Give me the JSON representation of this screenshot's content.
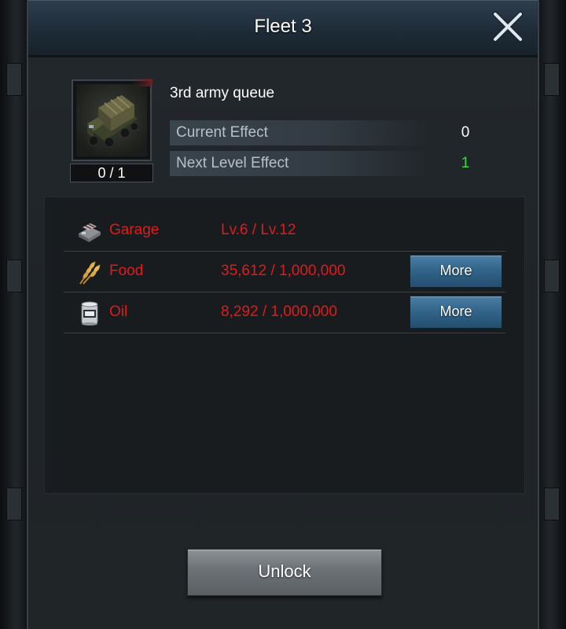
{
  "header": {
    "title": "Fleet 3"
  },
  "item": {
    "count": "0 / 1",
    "title": "3rd army queue"
  },
  "effects": [
    {
      "label": "Current Effect",
      "value": "0",
      "value_color": "#ffffff"
    },
    {
      "label": "Next Level Effect",
      "value": "1",
      "value_color": "#3ddc3d"
    }
  ],
  "requirements": [
    {
      "icon": "garage-icon",
      "name": "Garage",
      "amount": "Lv.6 / Lv.12",
      "button": null
    },
    {
      "icon": "wheat-icon",
      "name": "Food",
      "amount": "35,612 / 1,000,000",
      "button": "More"
    },
    {
      "icon": "oil-can-icon",
      "name": "Oil",
      "amount": "8,292 / 1,000,000",
      "button": "More"
    }
  ],
  "colors": {
    "requirement_unmet": "#e01b1b",
    "button_blue": "#33658b"
  },
  "footer": {
    "unlock_label": "Unlock"
  }
}
